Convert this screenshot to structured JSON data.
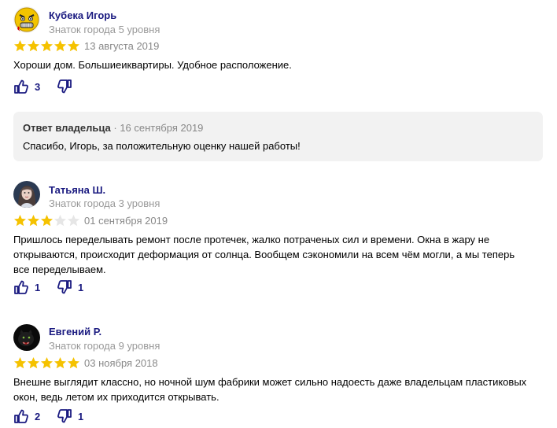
{
  "colors": {
    "star_filled": "#f5c200",
    "star_empty": "#e6e6e6",
    "author": "#1a1a80",
    "muted": "#999999",
    "icon": "#1a1a80",
    "reply_bg": "#f2f2f2"
  },
  "reviews": [
    {
      "author": "Кубека Игорь",
      "level": "Знаток города 5 уровня",
      "rating": 5,
      "date": "13 августа 2019",
      "text": "Хороши дом. Большиеиквартиры. Удобное расположение.",
      "likes": "3",
      "dislikes": "",
      "avatar_icon": "angry-face-icon"
    },
    {
      "author": "Татьяна Ш.",
      "level": "Знаток города 3 уровня",
      "rating": 3,
      "date": "01 сентября 2019",
      "text": "Пришлось переделывать ремонт после протечек, жалко потраченых сил и времени. Окна в жару не открываются, происходит деформация от солнца. Вообщем сэкономили на всем чём могли, а мы теперь все переделываем.",
      "likes": "1",
      "dislikes": "1",
      "avatar_icon": "woman-portrait-icon"
    },
    {
      "author": "Евгений Р.",
      "level": "Знаток города 9 уровня",
      "rating": 5,
      "date": "03 ноября 2018",
      "text": "Внешне выглядит классно, но ночной шум фабрики может сильно надоесть даже владельцам пластиковых окон, ведь летом их приходится открывать.",
      "likes": "2",
      "dislikes": "1",
      "avatar_icon": "panther-icon"
    }
  ],
  "owner_reply": {
    "label": "Ответ владельца",
    "separator": " · ",
    "date": "16 сентября 2019",
    "text": "Спасибо, Игорь, за положительную оценку нашей работы!"
  }
}
